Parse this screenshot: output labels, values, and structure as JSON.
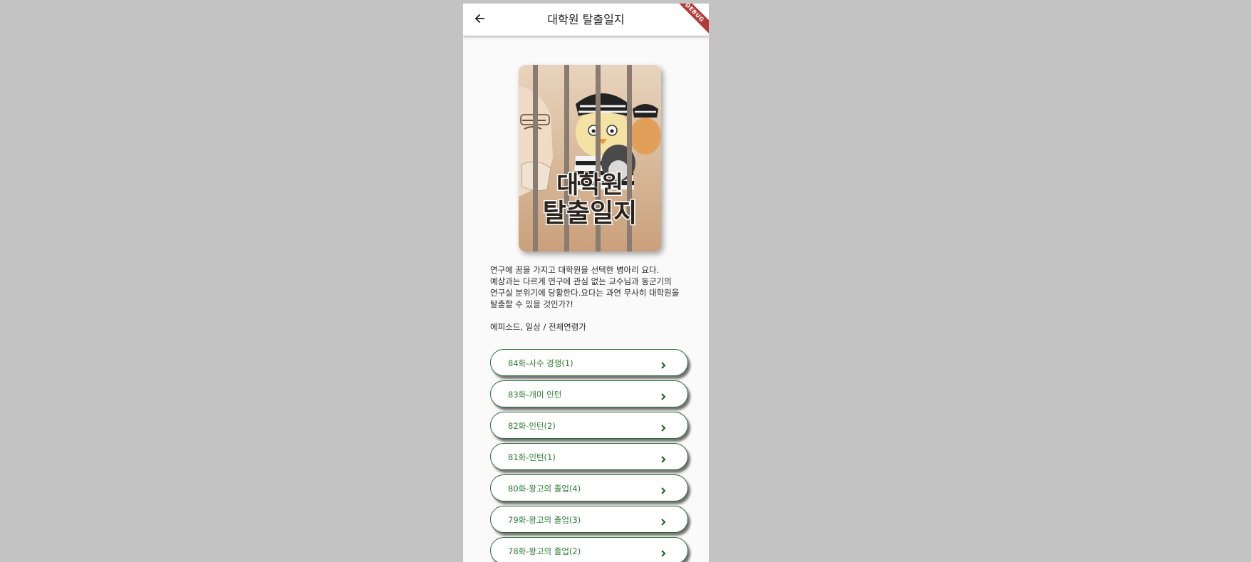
{
  "appbar": {
    "title": "대학원 탈출일지",
    "back_icon": "arrow-left-icon",
    "debug_banner": "DEBUG"
  },
  "cover": {
    "image": "webtoon-cover-image",
    "title_art_line1": "대학원",
    "title_art_line2": "탈출일지"
  },
  "description": "연구에 꿈을 가지고 대학원을 선택한 병아리 요다.예상과는 다르게 연구에 관심 없는 교수님과 동군기의 연구실 분위기에 당황한다.요다는 과연 무사히 대학원을 탈출할 수 있을 것인가?!",
  "genre": "에피소드, 일상 / 전체연령가",
  "episodes": [
    {
      "label": "84화-사수 경쟁(1)"
    },
    {
      "label": "83화-개미 인턴"
    },
    {
      "label": "82화-인턴(2)"
    },
    {
      "label": "81화-인턴(1)"
    },
    {
      "label": "80화-왕고의 졸업(4)"
    },
    {
      "label": "79화-왕고의 졸업(3)"
    },
    {
      "label": "78화-왕고의 졸업(2)"
    }
  ],
  "colors": {
    "episode_text": "#2e7d32",
    "episode_border": "#2e6b3a",
    "background": "#c3c3c3"
  }
}
